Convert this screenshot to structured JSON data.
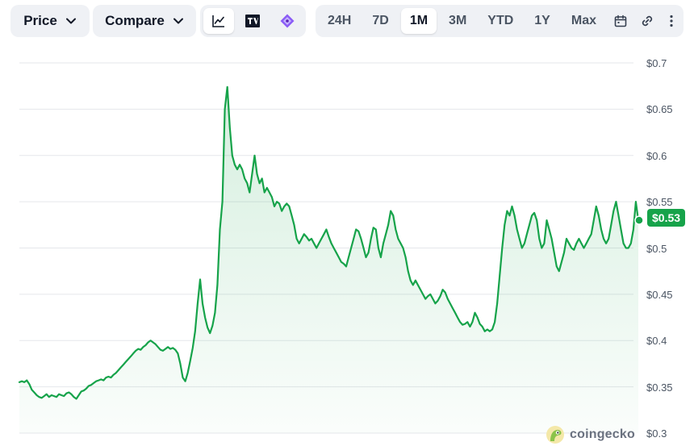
{
  "toolbar": {
    "price_dropdown": "Price",
    "compare_dropdown": "Compare",
    "chart_modes": [
      "line-chart-icon",
      "tradingview-icon",
      "candlestick-gem-icon"
    ],
    "active_chart_mode": "line-chart-icon",
    "ranges": [
      "24H",
      "7D",
      "1M",
      "3M",
      "YTD",
      "1Y",
      "Max"
    ],
    "active_range": "1M",
    "extra_icons": [
      "calendar-icon",
      "link-icon",
      "more-vertical-icon"
    ]
  },
  "current_price_label": "$0.53",
  "watermark": "coingecko",
  "colors": {
    "line": "#16a34a",
    "fill": "#16a34a",
    "grid": "#e5e7eb",
    "toolbar_bg": "#eff1f5"
  },
  "chart_data": {
    "type": "area",
    "ylim": [
      0.3,
      0.7
    ],
    "yticks": [
      0.7,
      0.65,
      0.6,
      0.55,
      0.5,
      0.45,
      0.4,
      0.35,
      0.3
    ],
    "ytick_labels": [
      "$0.7",
      "$0.65",
      "$0.6",
      "$0.55",
      "$0.5",
      "$0.45",
      "$0.4",
      "$0.35",
      "$0.3"
    ],
    "y_axis_position": "right",
    "grid": true,
    "x_range_label": "1M",
    "last_value": 0.53,
    "series": [
      {
        "values": [
          0.355,
          0.356,
          0.355,
          0.357,
          0.353,
          0.347,
          0.344,
          0.341,
          0.339,
          0.338,
          0.34,
          0.342,
          0.339,
          0.341,
          0.34,
          0.339,
          0.342,
          0.341,
          0.34,
          0.343,
          0.344,
          0.342,
          0.339,
          0.337,
          0.341,
          0.345,
          0.346,
          0.348,
          0.351,
          0.352,
          0.354,
          0.356,
          0.357,
          0.358,
          0.357,
          0.36,
          0.361,
          0.36,
          0.363,
          0.365,
          0.368,
          0.371,
          0.374,
          0.377,
          0.38,
          0.383,
          0.386,
          0.389,
          0.391,
          0.39,
          0.393,
          0.395,
          0.398,
          0.4,
          0.398,
          0.396,
          0.393,
          0.39,
          0.389,
          0.391,
          0.393,
          0.391,
          0.392,
          0.39,
          0.386,
          0.375,
          0.36,
          0.356,
          0.365,
          0.378,
          0.392,
          0.41,
          0.44,
          0.466,
          0.44,
          0.425,
          0.414,
          0.408,
          0.416,
          0.43,
          0.46,
          0.52,
          0.55,
          0.65,
          0.674,
          0.63,
          0.6,
          0.59,
          0.585,
          0.59,
          0.585,
          0.575,
          0.57,
          0.56,
          0.58,
          0.6,
          0.58,
          0.57,
          0.575,
          0.56,
          0.565,
          0.56,
          0.555,
          0.545,
          0.55,
          0.548,
          0.54,
          0.545,
          0.548,
          0.545,
          0.535,
          0.525,
          0.51,
          0.505,
          0.51,
          0.515,
          0.512,
          0.508,
          0.51,
          0.505,
          0.5,
          0.505,
          0.51,
          0.515,
          0.52,
          0.512,
          0.505,
          0.5,
          0.495,
          0.49,
          0.485,
          0.483,
          0.48,
          0.49,
          0.5,
          0.51,
          0.52,
          0.518,
          0.51,
          0.5,
          0.49,
          0.495,
          0.51,
          0.522,
          0.52,
          0.5,
          0.49,
          0.505,
          0.515,
          0.525,
          0.54,
          0.535,
          0.52,
          0.51,
          0.505,
          0.5,
          0.49,
          0.475,
          0.465,
          0.46,
          0.465,
          0.46,
          0.455,
          0.45,
          0.445,
          0.448,
          0.45,
          0.445,
          0.44,
          0.443,
          0.448,
          0.455,
          0.452,
          0.445,
          0.44,
          0.435,
          0.43,
          0.425,
          0.42,
          0.417,
          0.418,
          0.42,
          0.415,
          0.42,
          0.43,
          0.425,
          0.418,
          0.415,
          0.41,
          0.412,
          0.41,
          0.412,
          0.42,
          0.44,
          0.47,
          0.5,
          0.525,
          0.54,
          0.535,
          0.545,
          0.535,
          0.52,
          0.51,
          0.5,
          0.505,
          0.515,
          0.525,
          0.535,
          0.538,
          0.53,
          0.51,
          0.5,
          0.505,
          0.53,
          0.52,
          0.51,
          0.495,
          0.48,
          0.475,
          0.485,
          0.495,
          0.51,
          0.505,
          0.5,
          0.498,
          0.505,
          0.51,
          0.505,
          0.5,
          0.505,
          0.51,
          0.515,
          0.53,
          0.545,
          0.535,
          0.52,
          0.51,
          0.505,
          0.51,
          0.525,
          0.54,
          0.55,
          0.535,
          0.52,
          0.505,
          0.5,
          0.5,
          0.505,
          0.52,
          0.55,
          0.53
        ]
      }
    ]
  }
}
